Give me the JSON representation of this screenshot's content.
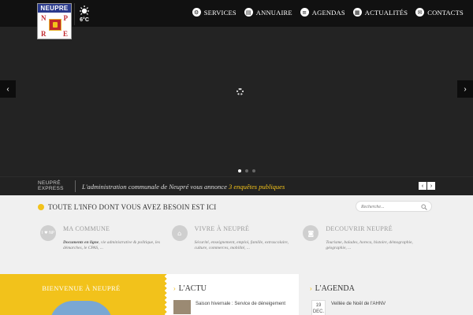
{
  "logo": {
    "brand": "NEUPRE",
    "letters": [
      "N",
      "P",
      "R",
      "E"
    ]
  },
  "weather": {
    "icon": "sun-icon",
    "temp": "6°C"
  },
  "nav": {
    "items": [
      {
        "label": "SERVICES",
        "icon": "gear-icon"
      },
      {
        "label": "ANNUAIRE",
        "icon": "book-icon"
      },
      {
        "label": "AGENDAS",
        "icon": "list-icon"
      },
      {
        "label": "ACTUALITÉS",
        "icon": "news-icon"
      },
      {
        "label": "CONTACTS",
        "icon": "mail-icon"
      }
    ]
  },
  "slider": {
    "prev": "‹",
    "next": "›",
    "dots": 3,
    "active_dot": 0
  },
  "express": {
    "title_line1": "NEUPRÉ",
    "title_line2": "EXPRESS",
    "text": "L'administration communale de Neupré vous annonce",
    "highlight": "3 enquêtes publiques",
    "prev": "‹",
    "next": "›"
  },
  "info": {
    "title": "TOUTE L'INFO DONT VOUS AVEZ BESOIN EST ICI",
    "search_placeholder": "Recherche...",
    "columns": [
      {
        "icon_text": "I ♥ NP",
        "title": "MA COMMUNE",
        "bold": "Documents en ligne",
        "text": ", vie administrative & politique, les démarches, le CPAS, ..."
      },
      {
        "icon_text": "⌂",
        "title": "VIVRE À NEUPRÉ",
        "bold": "",
        "text": "Sécurité, enseignement, emploi, famille, extrascolaire, culture, commerces, mobilité, ..."
      },
      {
        "icon_text": "◙",
        "title": "DECOUVRIR NEUPRÉ",
        "bold": "",
        "text": "Tourisme, balades, horeca, histoire, démographie, géographie, ..."
      }
    ]
  },
  "bottom": {
    "welcome_title": "BIENVENUE À NEUPRÉ",
    "actu_title": "L'ACTU",
    "actu_item": "Saison hivernale : Service de déneigement",
    "agenda_title": "L'AGENDA",
    "agenda_day": "19",
    "agenda_month": "DEC.",
    "agenda_item": "Veillée de Noël de l'AHNV"
  },
  "colors": {
    "accent": "#f2c21b",
    "header_bg": "#111111",
    "slider_bg": "#232323",
    "info_bg": "#f0f0f0"
  }
}
